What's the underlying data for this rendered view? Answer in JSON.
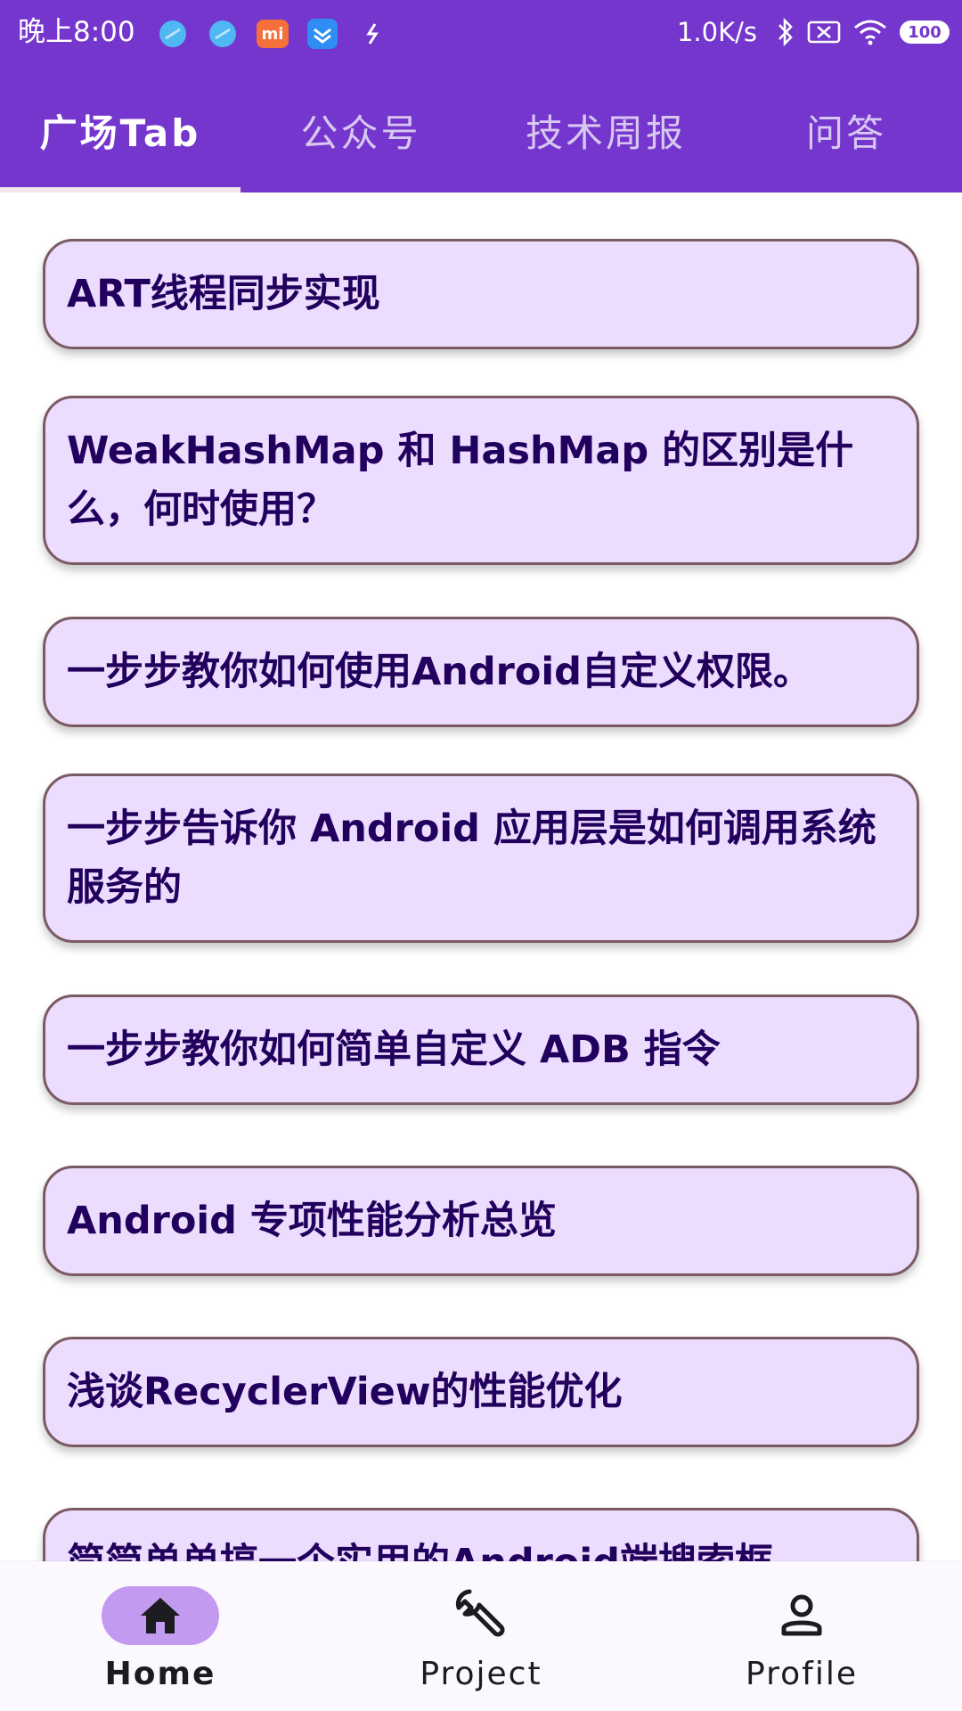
{
  "status_bar": {
    "time": "晚上8:00",
    "net_speed": "1.0K/s",
    "battery": "100"
  },
  "tabs": [
    {
      "label": "广场Tab",
      "active": true
    },
    {
      "label": "公众号",
      "active": false
    },
    {
      "label": "技术周报",
      "active": false
    },
    {
      "label": "问答",
      "active": false
    }
  ],
  "articles": [
    {
      "title": "ART线程同步实现"
    },
    {
      "title": "WeakHashMap 和 HashMap 的区别是什么，何时使用？"
    },
    {
      "title": "一步步教你如何使用Android自定义权限。"
    },
    {
      "title": "一步步告诉你 Android 应用层是如何调用系统服务的"
    },
    {
      "title": "一步步教你如何简单自定义 ADB 指令"
    },
    {
      "title": "Android 专项性能分析总览"
    },
    {
      "title": "浅谈RecyclerView的性能优化"
    },
    {
      "title": "简简单单搞一个实用的Android端搜索框"
    }
  ],
  "bottom_nav": [
    {
      "label": "Home",
      "icon": "home-icon",
      "active": true
    },
    {
      "label": "Project",
      "icon": "wrench-icon",
      "active": false
    },
    {
      "label": "Profile",
      "icon": "person-icon",
      "active": false
    }
  ],
  "colors": {
    "primary": "#7436cc",
    "card_bg": "#ecdcfd",
    "card_border": "#7b5b63",
    "card_text": "#22005d",
    "nav_active_pill": "#c29af0"
  }
}
